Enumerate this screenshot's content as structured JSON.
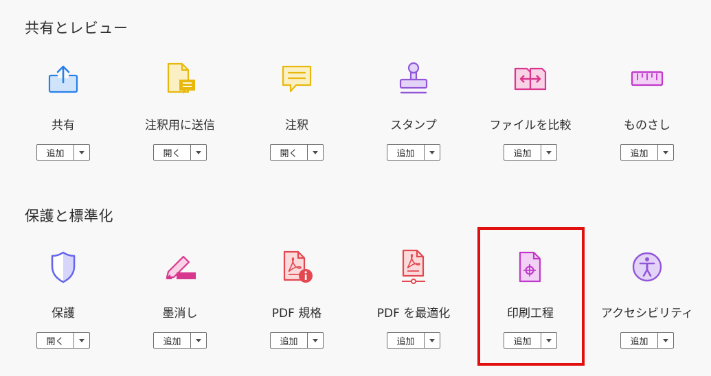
{
  "sections": [
    {
      "title": "共有とレビュー",
      "tools": [
        {
          "name": "共有",
          "action": "追加",
          "icon": "share-icon"
        },
        {
          "name": "注釈用に送信",
          "action": "開く",
          "icon": "send-for-comments-icon"
        },
        {
          "name": "注釈",
          "action": "開く",
          "icon": "comment-icon"
        },
        {
          "name": "スタンプ",
          "action": "追加",
          "icon": "stamp-icon"
        },
        {
          "name": "ファイルを比較",
          "action": "追加",
          "icon": "compare-files-icon"
        },
        {
          "name": "ものさし",
          "action": "追加",
          "icon": "ruler-icon"
        }
      ]
    },
    {
      "title": "保護と標準化",
      "tools": [
        {
          "name": "保護",
          "action": "開く",
          "icon": "shield-icon"
        },
        {
          "name": "墨消し",
          "action": "追加",
          "icon": "redact-icon"
        },
        {
          "name": "PDF 規格",
          "action": "追加",
          "icon": "pdf-standards-icon"
        },
        {
          "name": "PDF を最適化",
          "action": "追加",
          "icon": "optimize-pdf-icon"
        },
        {
          "name": "印刷工程",
          "action": "追加",
          "icon": "print-production-icon"
        },
        {
          "name": "アクセシビリティ",
          "action": "追加",
          "icon": "accessibility-icon"
        }
      ]
    }
  ],
  "highlighted_tool": "印刷工程",
  "colors": {
    "share": "#2680eb",
    "send": "#e8b80c",
    "comment": "#e8b80c",
    "stamp": "#9256d9",
    "compare": "#d83790",
    "ruler": "#c038cc",
    "shield": "#6767ec",
    "redact": "#d83790",
    "pdf": "#e34850",
    "print": "#c038cc",
    "accessibility": "#9256d9",
    "highlight": "#e20f0f"
  }
}
